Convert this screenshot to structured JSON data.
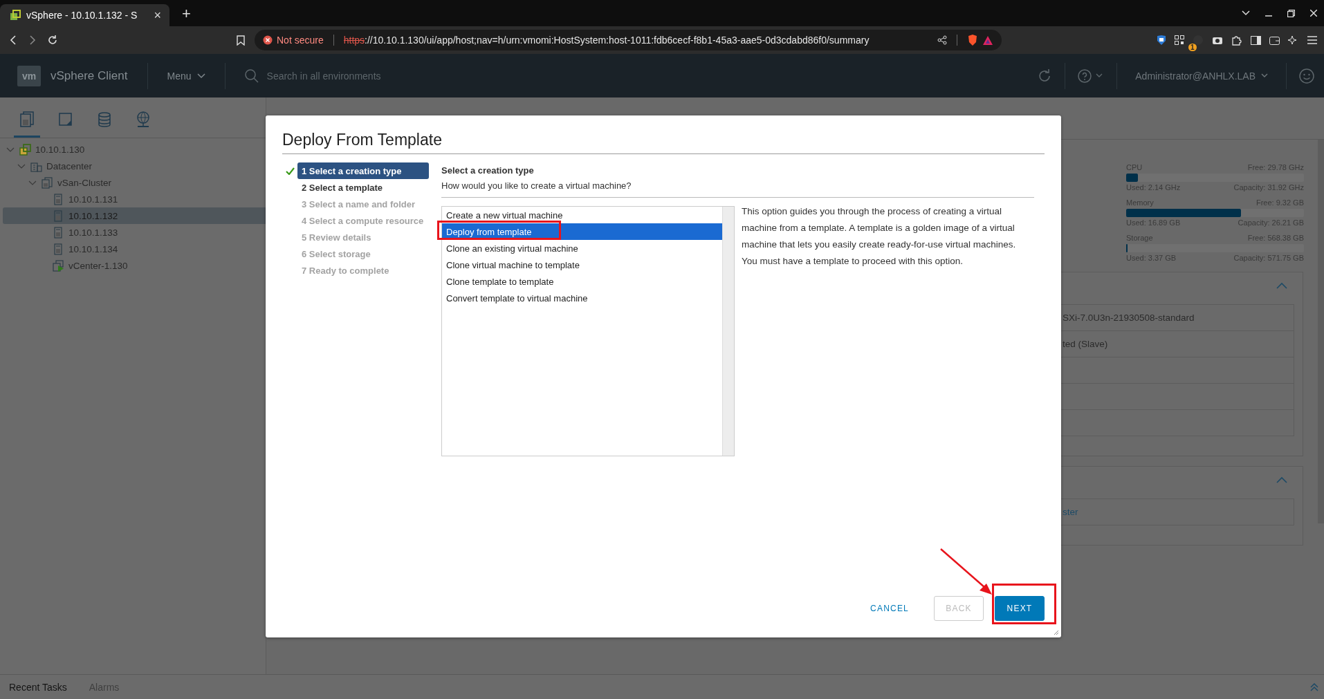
{
  "browser": {
    "tab": {
      "title": "vSphere - 10.10.1.132 - S",
      "close": "×"
    },
    "new_tab": "+",
    "address": {
      "security": "Not secure",
      "scheme": "https",
      "url_rest": "://10.10.1.130/ui/app/host;nav=h/urn:vmomi:HostSystem:host-1011:fdb6cecf-f8b1-45a3-aae5-0d3cdabd86f0/summary"
    },
    "extension_badge": "1"
  },
  "app_header": {
    "logo": "vm",
    "title": "vSphere Client",
    "menu": "Menu",
    "search": {
      "placeholder": "Search in all environments"
    },
    "user": "Administrator@ANHLX.LAB"
  },
  "nav_tabs": [
    {
      "kind": "hosts",
      "selected": true
    },
    {
      "kind": "vms",
      "selected": false
    },
    {
      "kind": "storage",
      "selected": false
    },
    {
      "kind": "network",
      "selected": false
    }
  ],
  "tree": [
    {
      "label": "10.10.1.130",
      "kind": "vcenter",
      "expanded": true,
      "selected": false,
      "children": [
        {
          "label": "Datacenter",
          "kind": "datacenter",
          "expanded": true,
          "selected": false,
          "children": [
            {
              "label": "vSan-Cluster",
              "kind": "cluster",
              "expanded": true,
              "selected": false,
              "children": [
                {
                  "label": "10.10.1.131",
                  "kind": "host",
                  "selected": false
                },
                {
                  "label": "10.10.1.132",
                  "kind": "host",
                  "selected": true
                },
                {
                  "label": "10.10.1.133",
                  "kind": "host",
                  "selected": false
                },
                {
                  "label": "10.10.1.134",
                  "kind": "host",
                  "selected": false
                },
                {
                  "label": "vCenter-1.130",
                  "kind": "vm",
                  "selected": false
                }
              ]
            }
          ]
        }
      ]
    }
  ],
  "resources": [
    {
      "name": "CPU",
      "free": "Free: 29.78 GHz",
      "level": 0.067,
      "used": "Used: 2.14 GHz",
      "capacity": "Capacity: 31.92 GHz"
    },
    {
      "name": "Memory",
      "free": "Free: 9.32 GB",
      "level": 0.644,
      "used": "Used: 16.89 GB",
      "capacity": "Capacity: 26.21 GB"
    },
    {
      "name": "Storage",
      "free": "Free: 568.38 GB",
      "level": 0.006,
      "used": "Used: 3.37 GB",
      "capacity": "Capacity: 571.75 GB"
    }
  ],
  "cards": [
    {
      "expanded": true,
      "rows": [
        "SXi-7.0U3n-21930508-standard",
        "ted (Slave)"
      ]
    },
    {
      "expanded": true,
      "rows": [
        "ster"
      ]
    }
  ],
  "dialog": {
    "title": "Deploy From Template",
    "steps": [
      {
        "label": "1 Select a creation type",
        "selected": true,
        "done": true,
        "disabled": false
      },
      {
        "label": "2 Select a template",
        "selected": false,
        "done": false,
        "disabled": false
      },
      {
        "label": "3 Select a name and folder",
        "selected": false,
        "done": false,
        "disabled": true
      },
      {
        "label": "4 Select a compute resource",
        "selected": false,
        "done": false,
        "disabled": true
      },
      {
        "label": "5 Review details",
        "selected": false,
        "done": false,
        "disabled": true
      },
      {
        "label": "6 Select storage",
        "selected": false,
        "done": false,
        "disabled": true
      },
      {
        "label": "7 Ready to complete",
        "selected": false,
        "done": false,
        "disabled": true
      }
    ],
    "section_title": "Select a creation type",
    "question": "How would you like to create a virtual machine?",
    "options": [
      {
        "label": "Create a new virtual machine",
        "selected": false,
        "annotated": false
      },
      {
        "label": "Deploy from template",
        "selected": true,
        "annotated": true
      },
      {
        "label": "Clone an existing virtual machine",
        "selected": false,
        "annotated": false
      },
      {
        "label": "Clone virtual machine to template",
        "selected": false,
        "annotated": false
      },
      {
        "label": "Clone template to template",
        "selected": false,
        "annotated": false
      },
      {
        "label": "Convert template to virtual machine",
        "selected": false,
        "annotated": false
      }
    ],
    "description": "This option guides you through the process of creating a virtual machine from a template. A template is a golden image of a virtual machine that lets you easily create ready-for-use virtual machines. You must have a template to proceed with this option.",
    "buttons": [
      {
        "kind": "link",
        "label": "CANCEL",
        "disabled": false,
        "annotated": false
      },
      {
        "kind": "outline",
        "label": "BACK",
        "disabled": true,
        "annotated": false
      },
      {
        "kind": "primary",
        "label": "NEXT",
        "disabled": false,
        "annotated": true
      }
    ]
  },
  "bottom_bar": {
    "tabs": [
      {
        "label": "Recent Tasks",
        "selected": true
      },
      {
        "label": "Alarms",
        "selected": false
      }
    ]
  }
}
